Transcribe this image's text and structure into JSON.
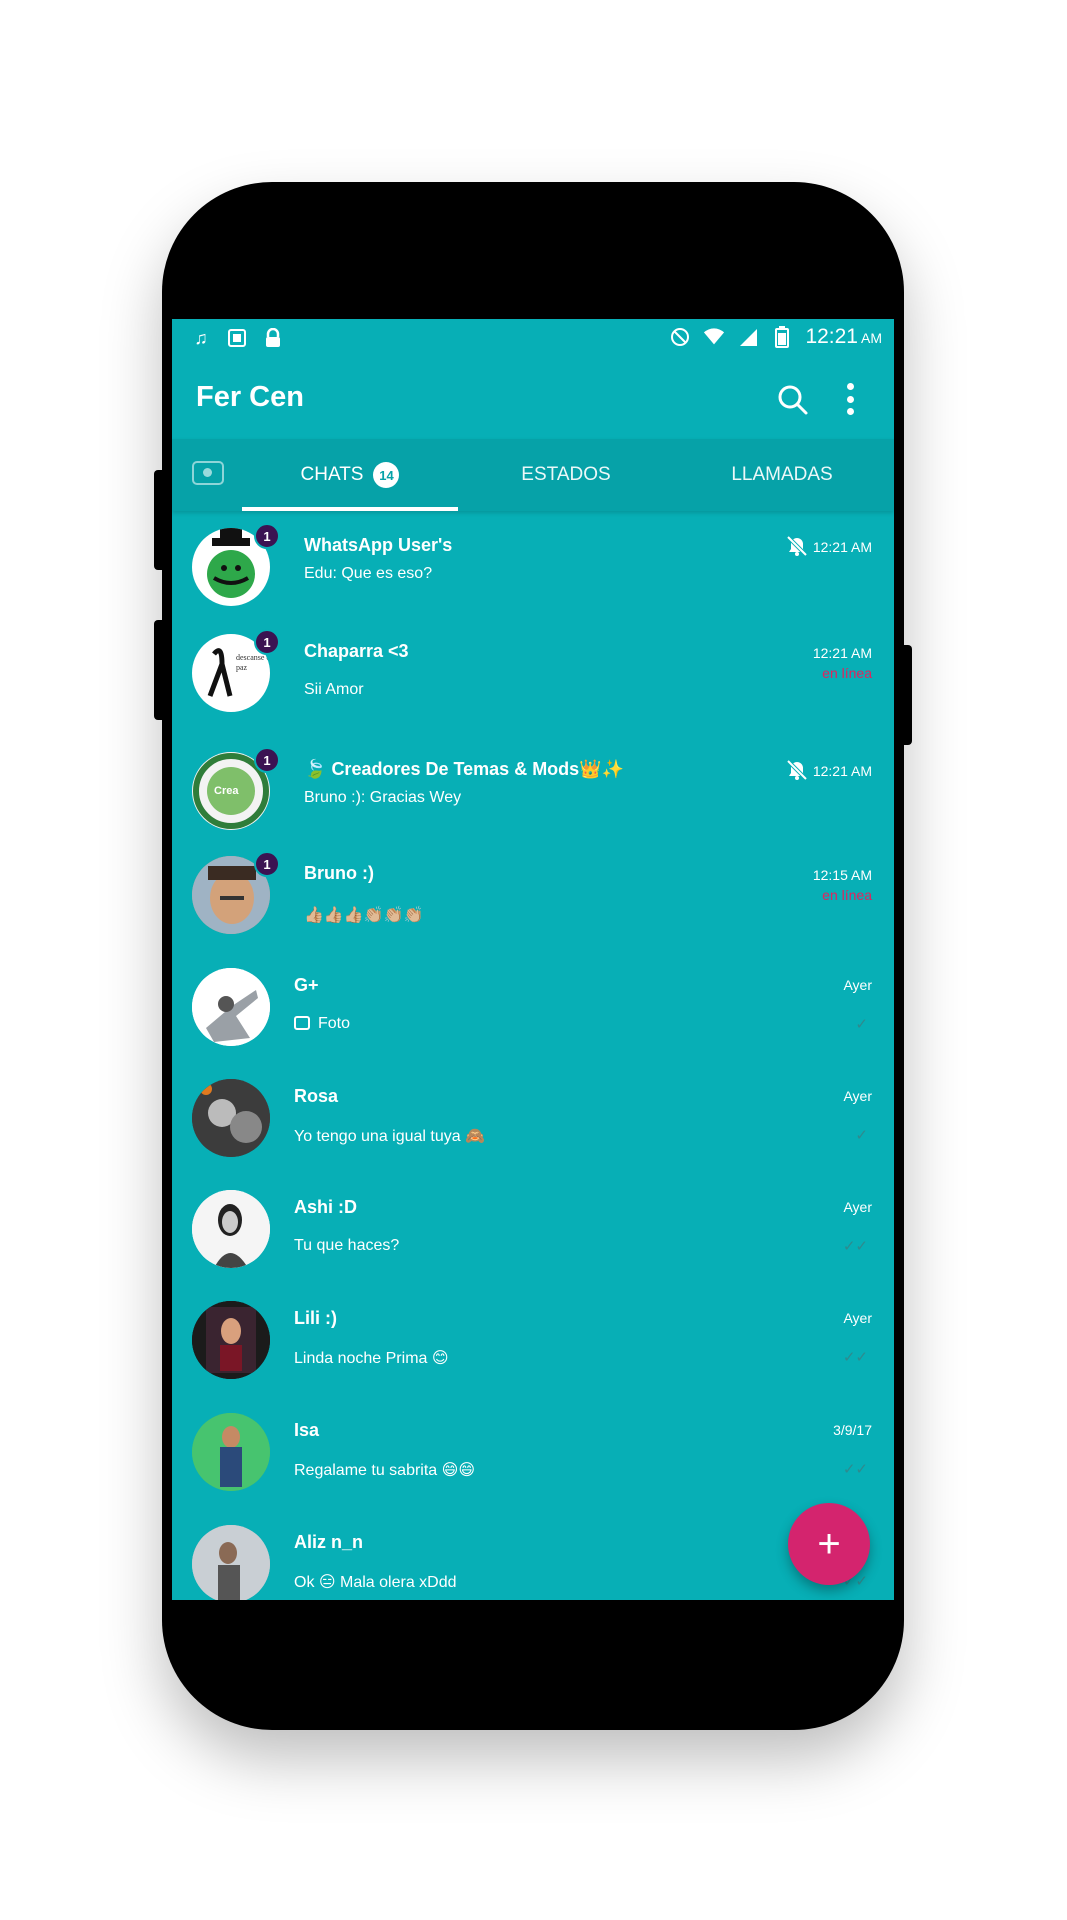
{
  "colors": {
    "primary": "#07afb6",
    "tab_bar": "#06a2a8",
    "accent": "#d4246e",
    "unread_badge": "#3b1352",
    "online_text": "#e0245e"
  },
  "status_bar": {
    "left_icons": [
      "music-note-icon",
      "gallery-icon",
      "lock-icon"
    ],
    "right_icons": [
      "do-not-disturb-icon",
      "wifi-icon",
      "signal-icon",
      "battery-icon"
    ],
    "time": "12:21",
    "ampm": "AM"
  },
  "app_bar": {
    "title": "Fer Cen",
    "icons": [
      "search-icon",
      "more-vert-icon"
    ]
  },
  "tabs": {
    "camera_icon": "camera-icon",
    "chats_label": "CHATS",
    "chats_badge": "14",
    "estados_label": "ESTADOS",
    "llamadas_label": "LLAMADAS",
    "selected": "CHATS"
  },
  "chats": [
    {
      "name": "WhatsApp User's",
      "message": "Edu: Que es eso?",
      "time": "12:21 AM",
      "unread": "1",
      "muted": true,
      "status": ""
    },
    {
      "name": "Chaparra <3",
      "message": "Sii Amor",
      "time": "12:21 AM",
      "unread": "1",
      "muted": false,
      "status": "en línea"
    },
    {
      "name": "Creadores De Temas & Mods",
      "message": "Bruno :): Gracias Wey",
      "time": "12:21 AM",
      "unread": "1",
      "muted": true,
      "status": ""
    },
    {
      "name": "Bruno :)",
      "message": "👍🏼👍🏼👍🏼👏🏼👏🏼👏🏼",
      "time": "12:15 AM",
      "unread": "1",
      "muted": false,
      "status": "en línea"
    },
    {
      "name": "G+",
      "message": "Foto",
      "time": "Ayer",
      "unread": "",
      "muted": false,
      "status": "",
      "tick": "✓"
    },
    {
      "name": "Rosa",
      "message": "Yo tengo una igual tuya 🙈",
      "time": "Ayer",
      "unread": "",
      "muted": false,
      "status": "",
      "tick": "✓"
    },
    {
      "name": "Ashi :D",
      "message": "Tu que haces?",
      "time": "Ayer",
      "unread": "",
      "muted": false,
      "status": "",
      "tick": "✓✓"
    },
    {
      "name": "Lili :)",
      "message": "Linda noche Prima 😊",
      "time": "Ayer",
      "unread": "",
      "muted": false,
      "status": "",
      "tick": "✓✓"
    },
    {
      "name": "Isa",
      "message": "Regalame tu sabrita 😄😄",
      "time": "3/9/17",
      "unread": "",
      "muted": false,
      "status": "",
      "tick": "✓✓"
    },
    {
      "name": "Aliz n_n",
      "message": "Ok 😑 Mala olera xDdd",
      "time": "",
      "unread": "",
      "muted": false,
      "status": "",
      "tick": "✓✓"
    }
  ],
  "fab": {
    "label": "+"
  }
}
